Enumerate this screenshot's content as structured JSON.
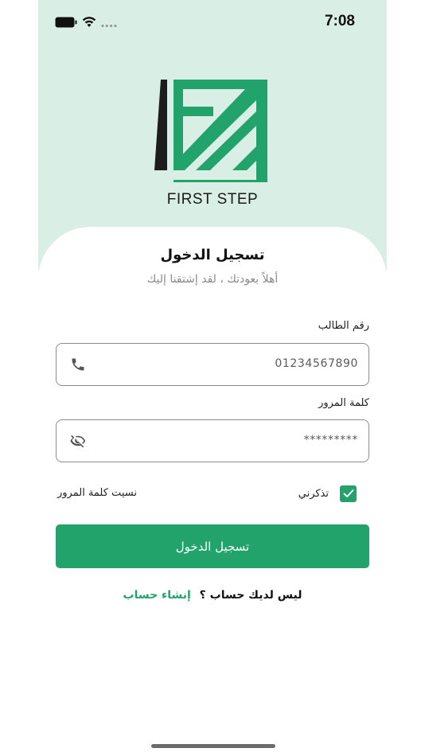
{
  "status_bar": {
    "time": "7:08"
  },
  "brand": {
    "name": "FIRST STEP",
    "primary_color": "#21a36b",
    "dark_color": "#1c1c1c",
    "band_color": "#d9efe5"
  },
  "login": {
    "title": "تسجيل الدخول",
    "subtitle": "أهلاً بعودتك ، لقد إشتقنا إليك",
    "student_number_label": "رقم الطالب",
    "student_number_value": "01234567890",
    "password_label": "كلمة المرور",
    "password_value": "*********",
    "remember_me_label": "تذكرني",
    "remember_me_checked": true,
    "forgot_password_label": "نسيت كلمة المرور",
    "submit_label": "تسجيل الدخول",
    "no_account_question": "ليس لديك حساب ؟",
    "create_account_link": "إنشاء حساب"
  },
  "icons": [
    "battery-icon",
    "wifi-icon",
    "signal-icon",
    "phone-icon",
    "eye-off-icon",
    "checkmark-icon"
  ]
}
